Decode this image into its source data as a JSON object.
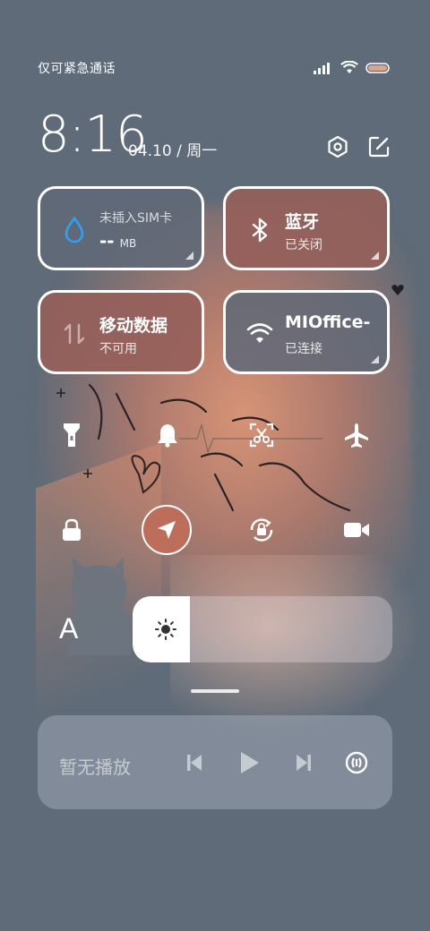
{
  "status_bar": {
    "carrier_text": "仅可紧急通话",
    "icons": [
      "signal-icon",
      "wifi-icon",
      "battery-icon"
    ]
  },
  "header": {
    "time": "8:16",
    "date_text": "04.10 / 周一",
    "icons": [
      "settings-icon",
      "edit-icon"
    ]
  },
  "tiles": {
    "sim": {
      "label": "未插入SIM卡",
      "value": "--",
      "unit": "MB",
      "icon": "water-drop-icon"
    },
    "bluetooth": {
      "title": "蓝牙",
      "status": "已关闭",
      "icon": "bluetooth-icon"
    },
    "mobile_data": {
      "title": "移动数据",
      "status": "不可用",
      "icon": "data-arrows-icon"
    },
    "wifi": {
      "title": "MIOffice-",
      "status": "已连接",
      "icon": "wifi-icon"
    }
  },
  "quick_toggles": [
    {
      "name": "flashlight",
      "icon": "flashlight-icon",
      "active": false
    },
    {
      "name": "mute",
      "icon": "bell-icon",
      "active": false
    },
    {
      "name": "screenshot",
      "icon": "scissors-icon",
      "active": false
    },
    {
      "name": "airplane",
      "icon": "airplane-icon",
      "active": false
    },
    {
      "name": "lock",
      "icon": "lock-icon",
      "active": false
    },
    {
      "name": "location",
      "icon": "location-arrow-icon",
      "active": true
    },
    {
      "name": "auto-rotate",
      "icon": "rotate-lock-icon",
      "active": false
    },
    {
      "name": "screen-record",
      "icon": "video-camera-icon",
      "active": false
    }
  ],
  "brightness": {
    "font_icon_label": "A",
    "level": 0.22,
    "icon": "sun-icon"
  },
  "media": {
    "title": "暂无播放",
    "controls": [
      "previous-icon",
      "play-icon",
      "next-icon",
      "cast-icon"
    ]
  },
  "colors": {
    "background": "#5f6b78",
    "tile_dark": "#5f6978",
    "tile_red": "#965f5a",
    "active_toggle": "#be6e5a"
  }
}
